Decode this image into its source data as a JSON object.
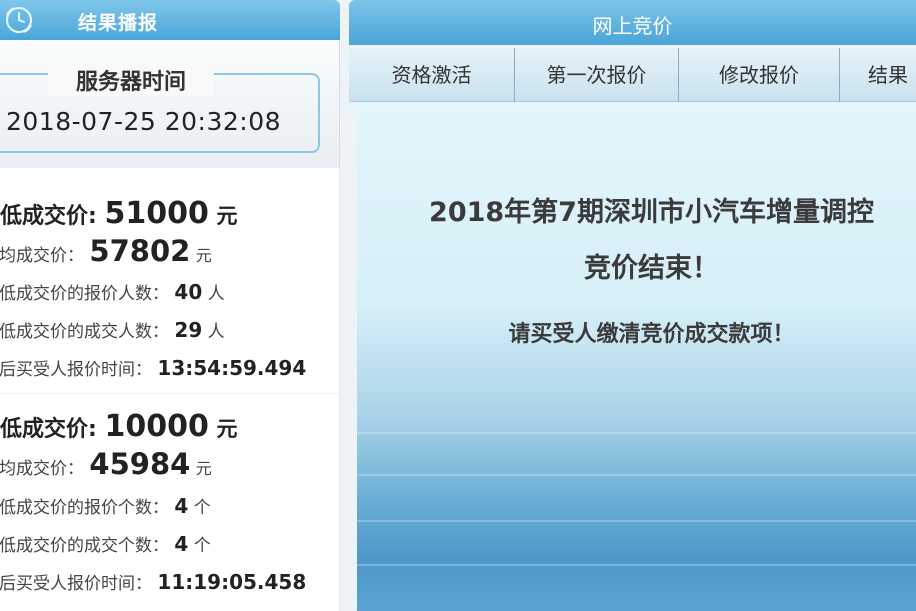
{
  "left": {
    "header_title": "结果播报",
    "server_time_label": "服务器时间",
    "server_time_value": "2018-07-25 20:32:08",
    "group1": {
      "min_price_label": "最低成交价:",
      "min_price_value": "51000",
      "min_price_unit": "元",
      "avg_price_label": "平均成交价：",
      "avg_price_value": "57802",
      "avg_price_unit": "元",
      "min_bidders_label": "最低成交价的报价人数：",
      "min_bidders_value": "40",
      "min_bidders_unit": "人",
      "min_deals_label": "最低成交价的成交人数：",
      "min_deals_value": "29",
      "min_deals_unit": "人",
      "last_time_label": "最后买受人报价时间：",
      "last_time_value": "13:54:59.494"
    },
    "group2": {
      "min_price_label": "最低成交价:",
      "min_price_value": "10000",
      "min_price_unit": "元",
      "avg_price_label": "平均成交价：",
      "avg_price_value": "45984",
      "avg_price_unit": "元",
      "min_bids_label": "最低成交价的报价个数：",
      "min_bids_value": "4",
      "min_bids_unit": "个",
      "min_deals_label": "最低成交价的成交个数：",
      "min_deals_value": "4",
      "min_deals_unit": "个",
      "last_time_label": "最后买受人报价时间：",
      "last_time_value": "11:19:05.458"
    }
  },
  "right": {
    "header_title": "网上竞价",
    "tabs": [
      {
        "label": "资格激活"
      },
      {
        "label": "第一次报价"
      },
      {
        "label": "修改报价"
      },
      {
        "label": "结果"
      }
    ],
    "message_line1": "2018年第7期深圳市小汽车增量调控",
    "message_line2": "竞价结束！",
    "message_line3": "请买受人缴清竞价成交款项！"
  },
  "colors": {
    "header_blue": "#4aa6d8",
    "frame_blue": "#8fc6e6"
  }
}
